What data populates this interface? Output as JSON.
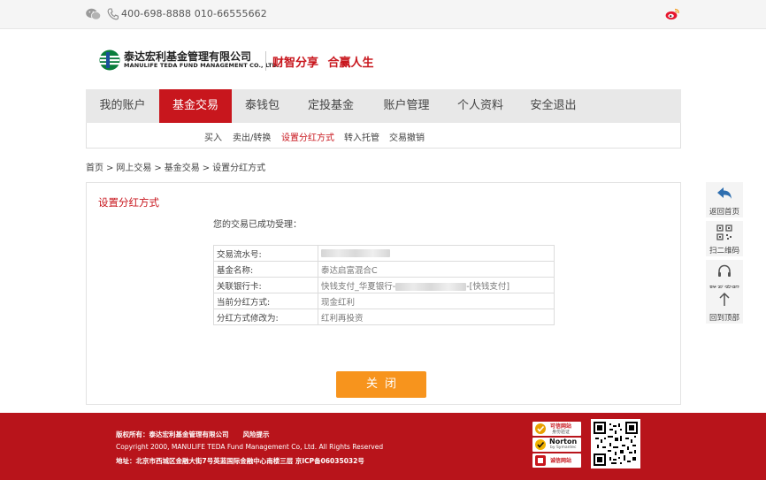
{
  "topbar": {
    "phone": "400-698-8888 010-66555662"
  },
  "header": {
    "company_cn": "泰达宏利基金管理有限公司",
    "company_en": "MANULIFE TEDA FUND MANAGEMENT CO., LTD.",
    "slogan": "财智分享  合赢人生"
  },
  "nav": {
    "items": [
      {
        "label": "我的账户"
      },
      {
        "label": "基金交易"
      },
      {
        "label": "泰钱包"
      },
      {
        "label": "定投基金"
      },
      {
        "label": "账户管理"
      },
      {
        "label": "个人资料"
      },
      {
        "label": "安全退出"
      }
    ],
    "active_index": 1
  },
  "subnav": {
    "items": [
      {
        "label": "买入"
      },
      {
        "label": "卖出/转换"
      },
      {
        "label": "设置分红方式"
      },
      {
        "label": "转入托管"
      },
      {
        "label": "交易撤销"
      }
    ],
    "active_index": 2
  },
  "breadcrumb": [
    "首页",
    ">",
    "网上交易",
    ">",
    "基金交易",
    ">",
    "设置分红方式"
  ],
  "panel": {
    "title": "设置分红方式",
    "message": "您的交易已成功受理：",
    "rows": [
      {
        "key": "交易流水号:",
        "value": ""
      },
      {
        "key": "基金名称:",
        "value": "泰达启富混合C"
      },
      {
        "key": "关联银行卡:",
        "value_prefix": "快钱支付_华夏银行-",
        "value_suffix": "-[快钱支付]"
      },
      {
        "key": "当前分红方式:",
        "value": "现金红利"
      },
      {
        "key": "分红方式修改为:",
        "value": "红利再投资"
      }
    ],
    "close_label": "关闭"
  },
  "side": {
    "items": [
      {
        "label": "返回首页",
        "icon": "back-arrow-icon"
      },
      {
        "label": "扫二维码",
        "icon": "qrcode-icon"
      },
      {
        "label": "联系客服",
        "icon": "headset-icon"
      },
      {
        "label": "回到顶部",
        "icon": "arrow-up-icon"
      }
    ]
  },
  "footer": {
    "copyright_label": "版权所有：",
    "copyright_owner": "泰达宏利基金管理有限公司",
    "risk_link": "风险提示",
    "copyright_en": "Copyright 2000, MANULIFE TEDA Fund Management Co, Ltd. All Rights Reserved",
    "address": "地址：北京市西城区金融大街7号英蓝国际金融中心南楼三层 京ICP备06035032号",
    "badges": [
      {
        "label": "可信网站",
        "sub": "身份验证"
      },
      {
        "label": "Norton",
        "sub": "by Symantec"
      },
      {
        "label": "诚信网站"
      }
    ]
  },
  "colors": {
    "brand_red": "#c8161d",
    "footer_red": "#b8141b",
    "close_button": "#f7941d",
    "nav_bg": "#e8e8e8"
  }
}
